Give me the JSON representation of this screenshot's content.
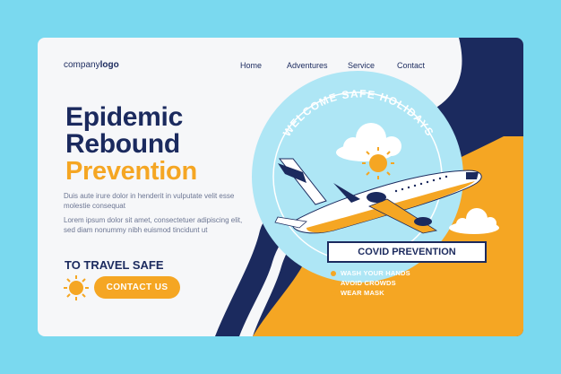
{
  "brand": {
    "logo_prefix": "company",
    "logo_bold": "logo"
  },
  "nav": {
    "items": [
      "Home",
      "Adventures",
      "Service",
      "Contact"
    ]
  },
  "hero": {
    "title_line1": "Epidemic",
    "title_line2": "Rebound",
    "title_line3": "Prevention",
    "paragraph1": "Duis aute irure dolor in henderit in vulputate velit esse molestie consequat",
    "paragraph2": "Lorem ipsum dolor sit amet, consectetuer adipiscing elit, sed diam nonummy nibh euismod tincidunt ut",
    "tagline": "TO TRAVEL SAFE",
    "cta_label": "CONTACT US"
  },
  "badge": {
    "arc_text": "WELCOME SAFE HOLIDAYS",
    "banner": "COVID PREVENTION",
    "tips": [
      "WASH YOUR HANDS",
      "AVOID CROWDS",
      "WEAR MASK"
    ]
  },
  "colors": {
    "background": "#7ad9ef",
    "navy": "#1b2a5e",
    "orange": "#f5a623",
    "light_blue": "#aee6f5",
    "card": "#f6f7f9"
  },
  "icons": [
    "sun-icon",
    "cloud-icon",
    "airplane-icon"
  ]
}
